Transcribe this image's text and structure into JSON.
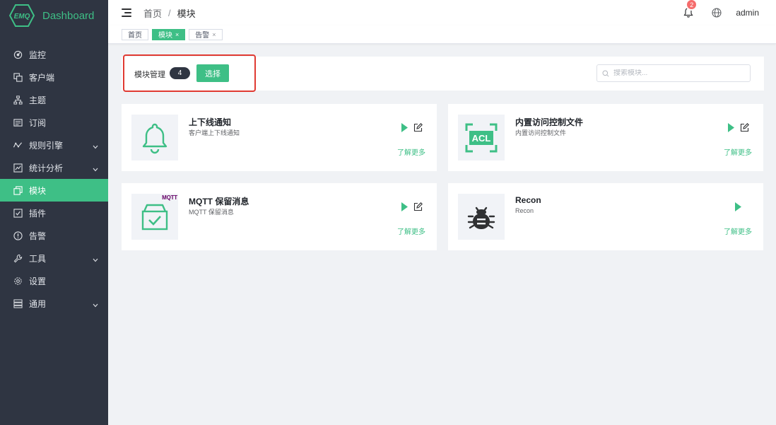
{
  "app": {
    "logo_mark": "EMQ",
    "title": "Dashboard"
  },
  "sidebar": {
    "items": [
      {
        "label": "监控",
        "icon": "monitor-icon",
        "expandable": false,
        "active": false
      },
      {
        "label": "客户端",
        "icon": "clients-icon",
        "expandable": false,
        "active": false
      },
      {
        "label": "主题",
        "icon": "topics-icon",
        "expandable": false,
        "active": false
      },
      {
        "label": "订阅",
        "icon": "subscriptions-icon",
        "expandable": false,
        "active": false
      },
      {
        "label": "规则引擎",
        "icon": "rule-engine-icon",
        "expandable": true,
        "active": false
      },
      {
        "label": "统计分析",
        "icon": "analysis-icon",
        "expandable": true,
        "active": false
      },
      {
        "label": "模块",
        "icon": "modules-icon",
        "expandable": false,
        "active": true
      },
      {
        "label": "插件",
        "icon": "plugins-icon",
        "expandable": false,
        "active": false
      },
      {
        "label": "告警",
        "icon": "alarm-icon",
        "expandable": false,
        "active": false
      },
      {
        "label": "工具",
        "icon": "tools-icon",
        "expandable": true,
        "active": false
      },
      {
        "label": "设置",
        "icon": "settings-icon",
        "expandable": false,
        "active": false
      },
      {
        "label": "通用",
        "icon": "general-icon",
        "expandable": true,
        "active": false
      }
    ]
  },
  "header": {
    "breadcrumb": [
      "首页",
      "模块"
    ],
    "breadcrumb_separator": "/",
    "notification_count": "2",
    "user": "admin"
  },
  "tags": [
    {
      "label": "首页",
      "active": false,
      "closable": false
    },
    {
      "label": "模块",
      "active": true,
      "closable": true
    },
    {
      "label": "告警",
      "active": false,
      "closable": true
    }
  ],
  "tag_close_glyph": "×",
  "toolbar": {
    "title": "模块管理",
    "count": "4",
    "select_label": "选择",
    "search_placeholder": "搜索模块..."
  },
  "modules": [
    {
      "title": "上下线通知",
      "desc": "客户端上下线通知",
      "icon": "bell-icon",
      "more": "了解更多",
      "has_edit": true
    },
    {
      "title": "内置访问控制文件",
      "desc": "内置访问控制文件",
      "icon": "acl-icon",
      "icon_text": "ACL",
      "more": "了解更多",
      "has_edit": true
    },
    {
      "title": "MQTT 保留消息",
      "desc": "MQTT 保留消息",
      "icon": "retained-box-icon",
      "icon_badge": "MQTT",
      "more": "了解更多",
      "has_edit": true
    },
    {
      "title": "Recon",
      "desc": "Recon",
      "icon": "bug-icon",
      "more": "了解更多",
      "has_edit": false
    }
  ],
  "colors": {
    "accent": "#3ebf86",
    "sidebar_bg": "#2f3542",
    "badge": "#f56c6c",
    "highlight_border": "#e03a32"
  }
}
